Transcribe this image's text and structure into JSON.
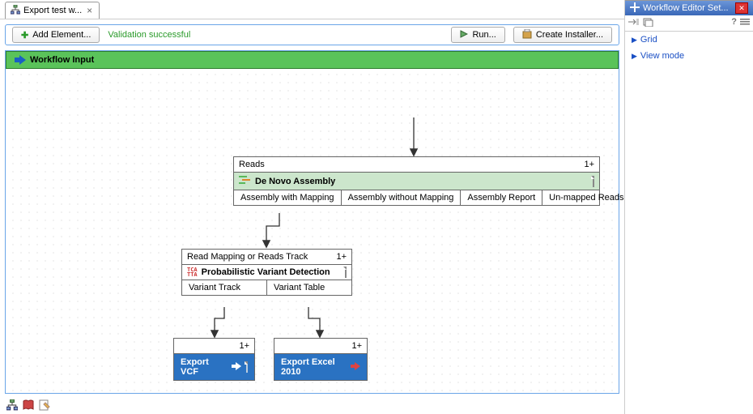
{
  "tab": {
    "title": "Export test w...",
    "full_title_hint": "Export test workflow"
  },
  "toolbar": {
    "add_element_label": "Add Element...",
    "validation_text": "Validation successful",
    "run_label": "Run...",
    "create_installer_label": "Create Installer..."
  },
  "workflow": {
    "input": {
      "label": "Workflow Input"
    },
    "assembly": {
      "input_row": {
        "label": "Reads",
        "count": "1+"
      },
      "title": "De Novo Assembly",
      "outputs": [
        "Assembly with Mapping",
        "Assembly without Mapping",
        "Assembly Report",
        "Un-mapped Reads"
      ]
    },
    "variant": {
      "input_row": {
        "label": "Read Mapping or Reads Track",
        "count": "1+"
      },
      "title": "Probabilistic Variant Detection",
      "outputs": [
        "Variant Track",
        "Variant Table"
      ]
    },
    "export_vcf": {
      "input_count": "1+",
      "label": "Export VCF"
    },
    "export_excel": {
      "input_count": "1+",
      "label": "Export Excel 2010"
    }
  },
  "side": {
    "title": "Workflow Editor Set...",
    "links": [
      "Grid",
      "View mode"
    ]
  }
}
